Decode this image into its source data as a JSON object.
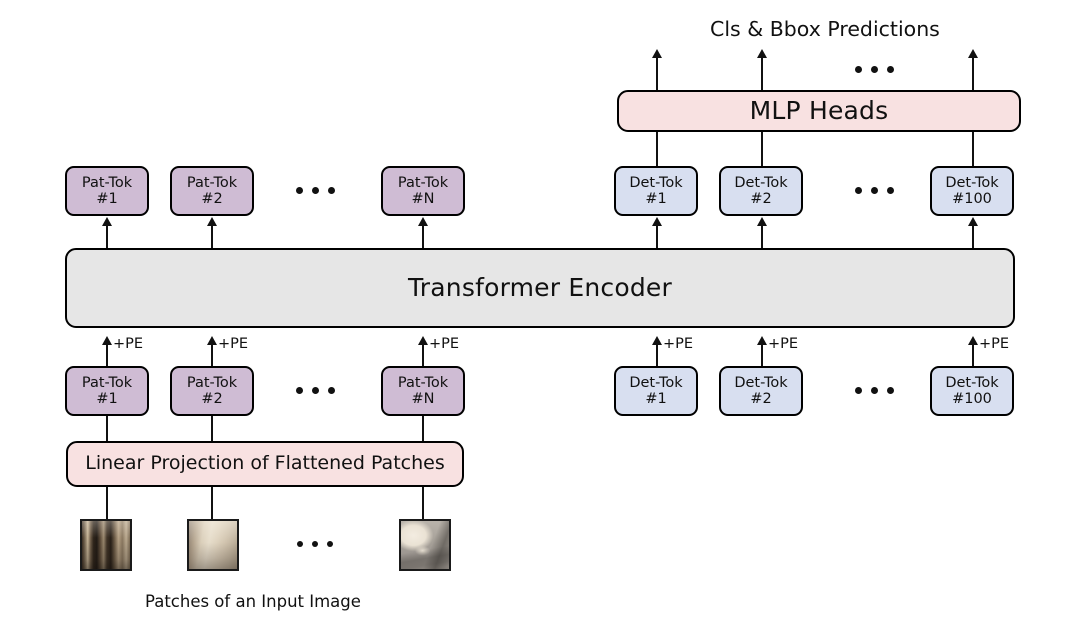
{
  "figure": {
    "top_caption": "Cls & Bbox Predictions",
    "bottom_caption": "Patches of an Input Image",
    "encoder_label": "Transformer Encoder",
    "mlp_label": "MLP Heads",
    "projection_label": "Linear Projection of Flattened Patches",
    "pe_label": "+PE",
    "ellipsis": "..."
  },
  "tokens": {
    "patch_output": [
      {
        "name": "Pat-Tok",
        "index": "#1"
      },
      {
        "name": "Pat-Tok",
        "index": "#2"
      },
      {
        "name": "Pat-Tok",
        "index": "#N"
      }
    ],
    "patch_input": [
      {
        "name": "Pat-Tok",
        "index": "#1"
      },
      {
        "name": "Pat-Tok",
        "index": "#2"
      },
      {
        "name": "Pat-Tok",
        "index": "#N"
      }
    ],
    "det_output": [
      {
        "name": "Det-Tok",
        "index": "#1"
      },
      {
        "name": "Det-Tok",
        "index": "#2"
      },
      {
        "name": "Det-Tok",
        "index": "#100"
      }
    ],
    "det_input": [
      {
        "name": "Det-Tok",
        "index": "#1"
      },
      {
        "name": "Det-Tok",
        "index": "#2"
      },
      {
        "name": "Det-Tok",
        "index": "#100"
      }
    ]
  },
  "pe_labels": [
    "+PE",
    "+PE",
    "+PE",
    "+PE",
    "+PE",
    "+PE"
  ],
  "patches": [
    {
      "name": "patch-image-1",
      "alt": "blurred street with columns"
    },
    {
      "name": "patch-image-2",
      "alt": "blurred city street buildings"
    },
    {
      "name": "patch-image-3",
      "alt": "white cat on pavement"
    }
  ],
  "colors": {
    "pat_token_fill": "#cfbcd4",
    "det_token_fill": "#d8dff0",
    "encoder_fill": "#e6e6e6",
    "pink_fill": "#f8e1e1",
    "stroke": "#111111"
  }
}
